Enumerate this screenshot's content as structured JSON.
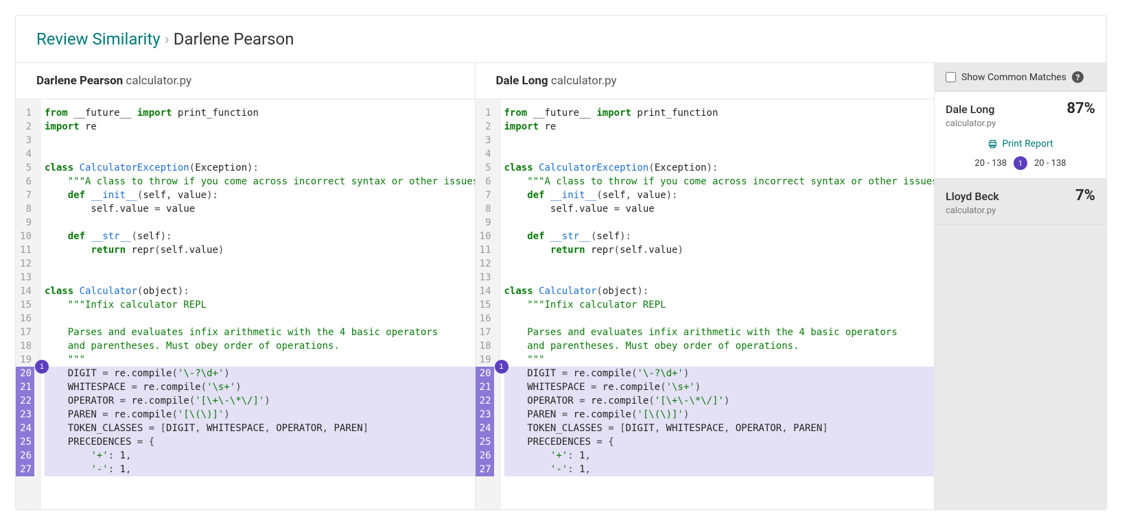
{
  "breadcrumb": {
    "root": "Review Similarity",
    "leaf": "Darlene Pearson"
  },
  "left": {
    "person": "Darlene Pearson",
    "file": "calculator.py"
  },
  "right": {
    "person": "Dale Long",
    "file": "calculator.py"
  },
  "common_matches_label": "Show Common Matches",
  "print_report_label": "Print Report",
  "match_badge": "1",
  "match_range_left": "20 - 138",
  "match_range_right": "20 - 138",
  "matches": [
    {
      "name": "Dale Long",
      "file": "calculator.py",
      "pct": "87%",
      "active": true
    },
    {
      "name": "Lloyd Beck",
      "file": "calculator.py",
      "pct": "7%",
      "active": false
    }
  ],
  "highlight_start": 20,
  "code_lines": [
    [
      [
        "kw",
        "from"
      ],
      [
        "plain",
        " __future__ "
      ],
      [
        "kw",
        "import"
      ],
      [
        "plain",
        " print_function"
      ]
    ],
    [
      [
        "kw",
        "import"
      ],
      [
        "plain",
        " re"
      ]
    ],
    [],
    [],
    [
      [
        "kw",
        "class"
      ],
      [
        "plain",
        " "
      ],
      [
        "ns",
        "CalculatorException"
      ],
      [
        "punc",
        "("
      ],
      [
        "plain",
        "Exception"
      ],
      [
        "punc",
        "):"
      ]
    ],
    [
      [
        "plain",
        "    "
      ],
      [
        "str",
        "\"\"\"A class to throw if you come across incorrect syntax or other issues\"\""
      ]
    ],
    [
      [
        "plain",
        "    "
      ],
      [
        "kw",
        "def"
      ],
      [
        "plain",
        " "
      ],
      [
        "ns",
        "__init__"
      ],
      [
        "punc",
        "("
      ],
      [
        "plain",
        "self"
      ],
      [
        "punc",
        ","
      ],
      [
        "plain",
        " value"
      ],
      [
        "punc",
        "):"
      ]
    ],
    [
      [
        "plain",
        "        self"
      ],
      [
        "punc",
        "."
      ],
      [
        "plain",
        "value "
      ],
      [
        "punc",
        "="
      ],
      [
        "plain",
        " value"
      ]
    ],
    [],
    [
      [
        "plain",
        "    "
      ],
      [
        "kw",
        "def"
      ],
      [
        "plain",
        " "
      ],
      [
        "ns",
        "__str__"
      ],
      [
        "punc",
        "("
      ],
      [
        "plain",
        "self"
      ],
      [
        "punc",
        "):"
      ]
    ],
    [
      [
        "plain",
        "        "
      ],
      [
        "kw",
        "return"
      ],
      [
        "plain",
        " repr"
      ],
      [
        "punc",
        "("
      ],
      [
        "plain",
        "self"
      ],
      [
        "punc",
        "."
      ],
      [
        "plain",
        "value"
      ],
      [
        "punc",
        ")"
      ]
    ],
    [],
    [],
    [
      [
        "kw",
        "class"
      ],
      [
        "plain",
        " "
      ],
      [
        "ns",
        "Calculator"
      ],
      [
        "punc",
        "("
      ],
      [
        "plain",
        "object"
      ],
      [
        "punc",
        "):"
      ]
    ],
    [
      [
        "plain",
        "    "
      ],
      [
        "str",
        "\"\"\"Infix calculator REPL"
      ]
    ],
    [],
    [
      [
        "plain",
        "    "
      ],
      [
        "str",
        "Parses and evaluates infix arithmetic with the 4 basic operators"
      ]
    ],
    [
      [
        "plain",
        "    "
      ],
      [
        "str",
        "and parentheses. Must obey order of operations."
      ]
    ],
    [
      [
        "plain",
        "    "
      ],
      [
        "str",
        "\"\"\""
      ]
    ],
    [
      [
        "plain",
        "    DIGIT "
      ],
      [
        "punc",
        "="
      ],
      [
        "plain",
        " re"
      ],
      [
        "punc",
        "."
      ],
      [
        "plain",
        "compile"
      ],
      [
        "punc",
        "("
      ],
      [
        "str",
        "'\\-?\\d+'"
      ],
      [
        "punc",
        ")"
      ]
    ],
    [
      [
        "plain",
        "    WHITESPACE "
      ],
      [
        "punc",
        "="
      ],
      [
        "plain",
        " re"
      ],
      [
        "punc",
        "."
      ],
      [
        "plain",
        "compile"
      ],
      [
        "punc",
        "("
      ],
      [
        "str",
        "'\\s+'"
      ],
      [
        "punc",
        ")"
      ]
    ],
    [
      [
        "plain",
        "    OPERATOR "
      ],
      [
        "punc",
        "="
      ],
      [
        "plain",
        " re"
      ],
      [
        "punc",
        "."
      ],
      [
        "plain",
        "compile"
      ],
      [
        "punc",
        "("
      ],
      [
        "str",
        "'[\\+\\-\\*\\/]'"
      ],
      [
        "punc",
        ")"
      ]
    ],
    [
      [
        "plain",
        "    PAREN "
      ],
      [
        "punc",
        "="
      ],
      [
        "plain",
        " re"
      ],
      [
        "punc",
        "."
      ],
      [
        "plain",
        "compile"
      ],
      [
        "punc",
        "("
      ],
      [
        "str",
        "'[\\(\\)]'"
      ],
      [
        "punc",
        ")"
      ]
    ],
    [
      [
        "plain",
        "    TOKEN_CLASSES "
      ],
      [
        "punc",
        "="
      ],
      [
        "plain",
        " "
      ],
      [
        "punc",
        "["
      ],
      [
        "plain",
        "DIGIT"
      ],
      [
        "punc",
        ","
      ],
      [
        "plain",
        " WHITESPACE"
      ],
      [
        "punc",
        ","
      ],
      [
        "plain",
        " OPERATOR"
      ],
      [
        "punc",
        ","
      ],
      [
        "plain",
        " PAREN"
      ],
      [
        "punc",
        "]"
      ]
    ],
    [
      [
        "plain",
        "    PRECEDENCES "
      ],
      [
        "punc",
        "="
      ],
      [
        "plain",
        " "
      ],
      [
        "punc",
        "{"
      ]
    ],
    [
      [
        "plain",
        "        "
      ],
      [
        "str",
        "'+'"
      ],
      [
        "punc",
        ":"
      ],
      [
        "plain",
        " "
      ],
      [
        "plain",
        "1"
      ],
      [
        "punc",
        ","
      ]
    ],
    [
      [
        "plain",
        "        "
      ],
      [
        "str",
        "'-'"
      ],
      [
        "punc",
        ":"
      ],
      [
        "plain",
        " "
      ],
      [
        "plain",
        "1"
      ],
      [
        "punc",
        ","
      ]
    ]
  ]
}
